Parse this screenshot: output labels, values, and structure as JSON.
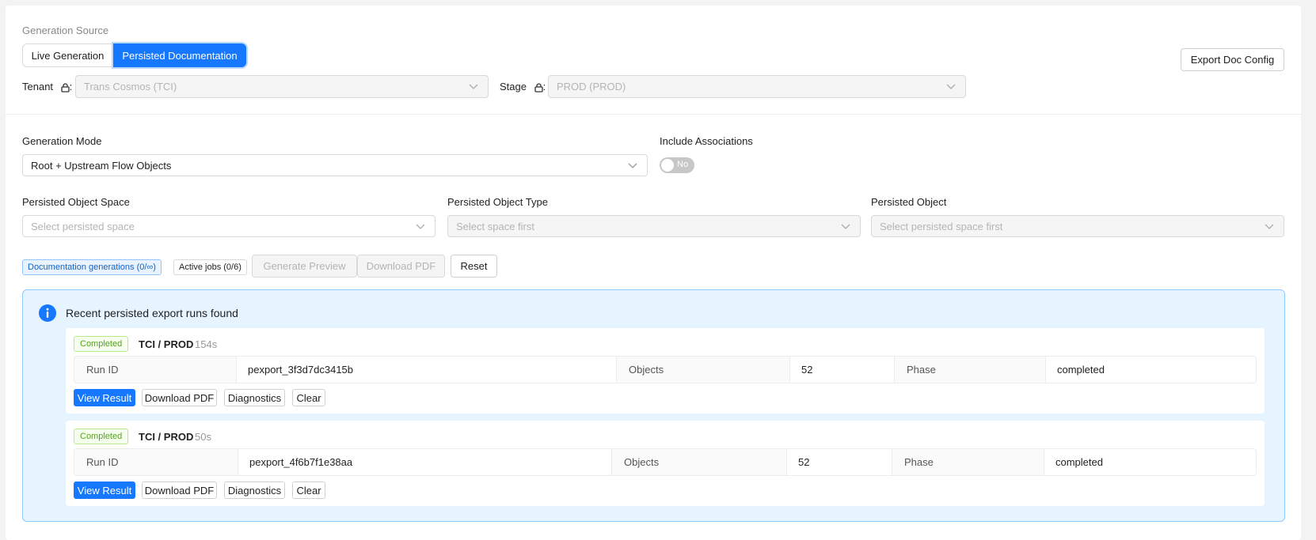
{
  "source": {
    "label": "Generation Source",
    "options": [
      "Live Generation",
      "Persisted Documentation"
    ],
    "selected": "Persisted Documentation",
    "export_button": "Export Doc Config"
  },
  "tenant": {
    "label": "Tenant",
    "value": "Trans Cosmos (TCI)"
  },
  "stage": {
    "label": "Stage",
    "value": "PROD (PROD)"
  },
  "mode": {
    "label": "Generation Mode",
    "value": "Root + Upstream Flow Objects"
  },
  "associations": {
    "label": "Include Associations",
    "toggle_text": "No",
    "on": false
  },
  "space": {
    "label": "Persisted Object Space",
    "placeholder": "Select persisted space"
  },
  "type": {
    "label": "Persisted Object Type",
    "placeholder": "Select space first"
  },
  "object": {
    "label": "Persisted Object",
    "placeholder": "Select persisted space first"
  },
  "actions": {
    "doc_tag": "Documentation generations (0/∞)",
    "jobs_tag": "Active jobs (0/6)",
    "generate": "Generate Preview",
    "download": "Download PDF",
    "reset": "Reset"
  },
  "alert": {
    "title": "Recent persisted export runs found",
    "runs": [
      {
        "status": "Completed",
        "title": "TCI / PROD",
        "duration": "154s",
        "run_id_label": "Run ID",
        "run_id": "pexport_3f3d7dc3415b",
        "objects_label": "Objects",
        "objects": "52",
        "phase_label": "Phase",
        "phase": "completed",
        "buttons": [
          "View Result",
          "Download PDF",
          "Diagnostics",
          "Clear"
        ]
      },
      {
        "status": "Completed",
        "title": "TCI / PROD",
        "duration": "50s",
        "run_id_label": "Run ID",
        "run_id": "pexport_4f6b7f1e38aa",
        "objects_label": "Objects",
        "objects": "52",
        "phase_label": "Phase",
        "phase": "completed",
        "buttons": [
          "View Result",
          "Download PDF",
          "Diagnostics",
          "Clear"
        ]
      }
    ]
  },
  "colors": {
    "primary": "#1677ff",
    "success": "#52a41a",
    "info_bg": "#e6f4ff"
  }
}
